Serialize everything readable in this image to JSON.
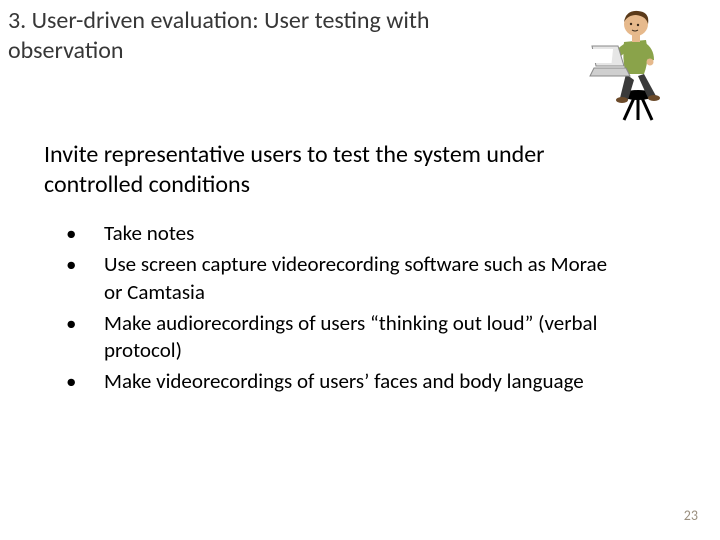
{
  "title": "3. User-driven evaluation: User testing with observation",
  "intro": "Invite representative users to test the system under controlled conditions",
  "bullets": {
    "b0": "Take notes",
    "b1": "Use screen capture videorecording software such as Morae or Camtasia",
    "b2": "Make audiorecordings of users “thinking out loud” (verbal protocol)",
    "b3": "Make videorecordings of users’ faces and body language"
  },
  "page_number": "23",
  "illustration_name": "person-with-laptop-illustration"
}
